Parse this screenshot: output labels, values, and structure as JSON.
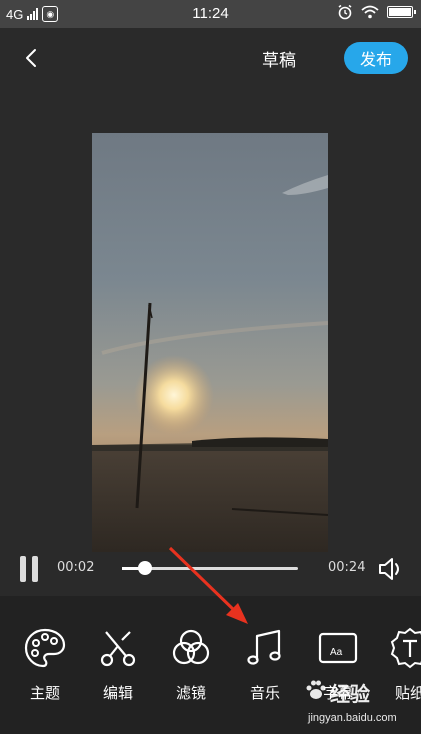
{
  "status_bar": {
    "network": "4G",
    "time": "11:24"
  },
  "header": {
    "back_icon": "chevron-left-icon",
    "draft_label": "草稿",
    "publish_label": "发布",
    "accent_color": "#27a7ea"
  },
  "player": {
    "current_time": "00:02",
    "total_time": "00:24",
    "progress_fraction": 0.13
  },
  "toolbar": {
    "items": [
      {
        "label": "主题",
        "icon": "palette-icon"
      },
      {
        "label": "编辑",
        "icon": "scissors-icon"
      },
      {
        "label": "滤镜",
        "icon": "filter-circles-icon"
      },
      {
        "label": "音乐",
        "icon": "music-note-icon"
      },
      {
        "label": "字幕",
        "icon": "subtitle-icon",
        "badge": "Aa"
      },
      {
        "label": "贴纸",
        "icon": "sticker-icon"
      }
    ]
  },
  "watermark": {
    "brand": "经验",
    "url": "jingyan.baidu.com"
  },
  "annotation": {
    "color": "#e8321f"
  }
}
